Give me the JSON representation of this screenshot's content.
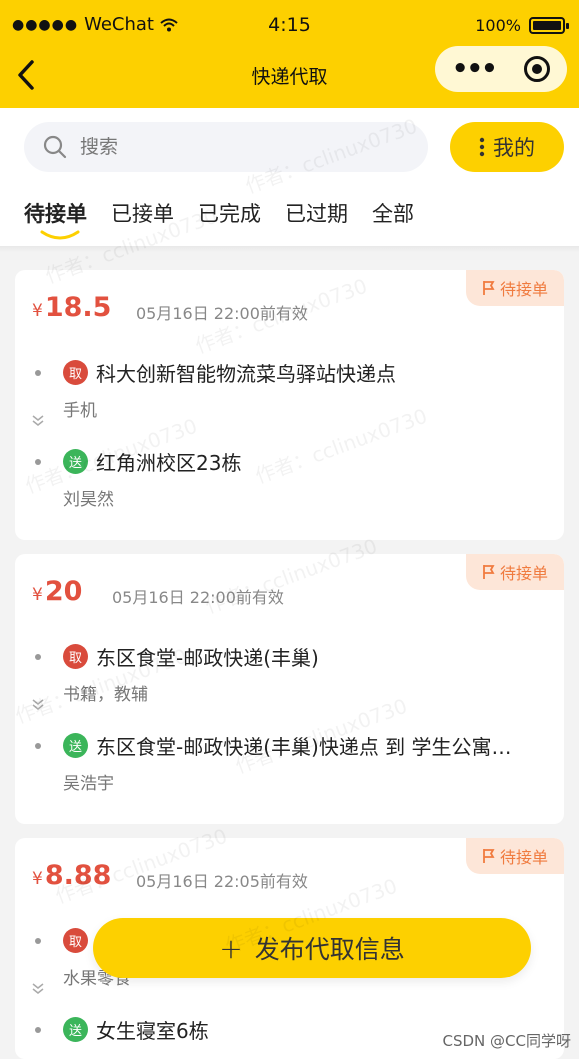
{
  "status_bar": {
    "signal": "●●●●●",
    "carrier": "WeChat",
    "time": "4:15",
    "battery": "100%"
  },
  "nav": {
    "title": "快递代取",
    "more": "•••"
  },
  "search": {
    "placeholder": "搜索",
    "mine_label": "我的"
  },
  "tabs": [
    {
      "label": "待接单",
      "active": true
    },
    {
      "label": "已接单"
    },
    {
      "label": "已完成"
    },
    {
      "label": "已过期"
    },
    {
      "label": "全部"
    }
  ],
  "orders": [
    {
      "currency": "¥",
      "price": "18.5",
      "expire": "05月16日 22:00前有效",
      "status": "待接单",
      "pickup": {
        "tag": "取",
        "place": "科大创新智能物流菜鸟驿站快递点",
        "detail": "手机"
      },
      "delivery": {
        "tag": "送",
        "place": "红角洲校区23栋",
        "detail": "刘昊然"
      }
    },
    {
      "currency": "¥",
      "price": "20",
      "expire": "05月16日 22:00前有效",
      "status": "待接单",
      "pickup": {
        "tag": "取",
        "place": "东区食堂-邮政快递(丰巢)",
        "detail": "书籍，教辅"
      },
      "delivery": {
        "tag": "送",
        "place": "东区食堂-邮政快递(丰巢)快递点 到 学生公寓…",
        "detail": "吴浩宇"
      }
    },
    {
      "currency": "¥",
      "price": "8.88",
      "expire": "05月16日 22:05前有效",
      "status": "待接单",
      "pickup": {
        "tag": "取",
        "place": "",
        "detail": "水果零食"
      },
      "delivery": {
        "tag": "送",
        "place": "女生寝室6栋",
        "detail": ""
      }
    }
  ],
  "fab": {
    "plus": "+",
    "label": "发布代取信息"
  },
  "watermark": "作者：cclinux0730",
  "footer_credit": "CSDN @CC同学呀",
  "colors": {
    "brand_yellow": "#fdd000",
    "price_red": "#e2513f",
    "status_orange": "#f07b3f",
    "pickup_red": "#d94b3c",
    "delivery_green": "#3bb55a"
  }
}
